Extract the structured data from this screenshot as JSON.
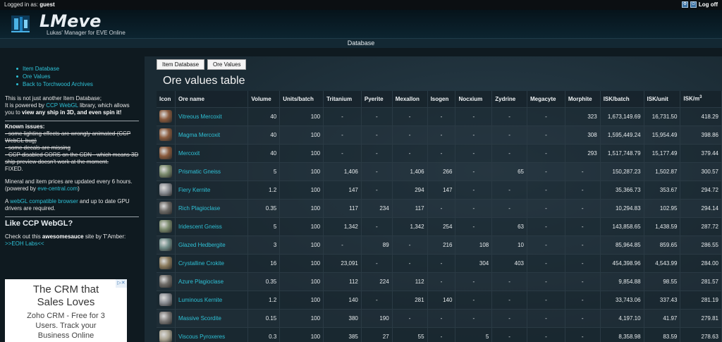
{
  "topbar": {
    "login_label": "Logged in as:",
    "login_user": "guest",
    "logoff": "Log off"
  },
  "header": {
    "title": "LMeve",
    "subtitle": "Lukas' Manager for EVE Online"
  },
  "nav": {
    "current": "Database"
  },
  "sidebar": {
    "links": [
      "Item Database",
      "Ore Values",
      "Back to Torchwood Archives"
    ],
    "intro_1": "This is not just another Item Database;",
    "intro_2_pre": "It is powered by ",
    "intro_2_link": "CCP WebGL",
    "intro_2_post": " library, which allows",
    "intro_3_pre": "you to ",
    "intro_3_bold": "view any ship in 3D, and even spin it!",
    "known_issues": "Known issues:",
    "issue_1": "- some lighting effects are wrongly animated (CCP WebGL bug)",
    "issue_2": "- some decals are missing",
    "issue_3": "- CCP disabled CORS on the CDN - which means 3D ship preview doesn't work at the moment.",
    "fixed": "FIXED.",
    "prices_1": "Mineral and item prices are updated every 6 hours.",
    "prices_2_pre": "(powered by ",
    "prices_2_link": "eve-central.com",
    "prices_2_post": ")",
    "webgl_pre": "A ",
    "webgl_link": "webGL compatible browser",
    "webgl_post": " and up to date GPU drivers are required.",
    "like_heading": "Like CCP WebGL?",
    "check_pre": "Check out this ",
    "check_bold": "awesomesauce",
    "check_post": " site by T'Amber:",
    "eoh_link": ">>EOH Labs<<"
  },
  "ad": {
    "line1": "The CRM that",
    "line2": "Sales Loves",
    "line3": "Zoho CRM - Free for 3",
    "line4": "Users. Track your",
    "line5": "Business Online"
  },
  "main": {
    "tabs": [
      "Item Database",
      "Ore Values"
    ],
    "title": "Ore values table",
    "columns": [
      "Icon",
      "Ore name",
      "Volume",
      "Units/batch",
      "Tritanium",
      "Pyerite",
      "Mexallon",
      "Isogen",
      "Nocxium",
      "Zydrine",
      "Megacyte",
      "Morphite",
      "ISK/batch",
      "ISK/unit",
      "ISK/m"
    ],
    "col_last_sup": "3",
    "rows": [
      {
        "icon_color": "#8a5a3c",
        "name": "Vitreous Mercoxit",
        "cells": [
          "40",
          "100",
          "-",
          "-",
          "-",
          "-",
          "-",
          "-",
          "-",
          "323",
          "1,673,149.69",
          "16,731.50",
          "418.29"
        ]
      },
      {
        "icon_color": "#8a5a3c",
        "name": "Magma Mercoxit",
        "cells": [
          "40",
          "100",
          "-",
          "-",
          "-",
          "-",
          "-",
          "-",
          "-",
          "308",
          "1,595,449.24",
          "15,954.49",
          "398.86"
        ]
      },
      {
        "icon_color": "#8a5a3c",
        "name": "Mercoxit",
        "cells": [
          "40",
          "100",
          "-",
          "-",
          "-",
          "-",
          "-",
          "-",
          "-",
          "293",
          "1,517,748.79",
          "15,177.49",
          "379.44"
        ]
      },
      {
        "icon_color": "#7a8a6c",
        "name": "Prismatic Gneiss",
        "cells": [
          "5",
          "100",
          "1,406",
          "-",
          "1,406",
          "266",
          "-",
          "65",
          "-",
          "-",
          "150,287.23",
          "1,502.87",
          "300.57"
        ]
      },
      {
        "icon_color": "#8c8f95",
        "name": "Fiery Kernite",
        "cells": [
          "1.2",
          "100",
          "147",
          "-",
          "294",
          "147",
          "-",
          "-",
          "-",
          "-",
          "35,366.73",
          "353.67",
          "294.72"
        ]
      },
      {
        "icon_color": "#6d6a66",
        "name": "Rich Plagioclase",
        "cells": [
          "0.35",
          "100",
          "117",
          "234",
          "117",
          "-",
          "-",
          "-",
          "-",
          "-",
          "10,294.83",
          "102.95",
          "294.14"
        ]
      },
      {
        "icon_color": "#7a8a6c",
        "name": "Iridescent Gneiss",
        "cells": [
          "5",
          "100",
          "1,342",
          "-",
          "1,342",
          "254",
          "-",
          "63",
          "-",
          "-",
          "143,858.65",
          "1,438.59",
          "287.72"
        ]
      },
      {
        "icon_color": "#6f8c88",
        "name": "Glazed Hedbergite",
        "cells": [
          "3",
          "100",
          "-",
          "89",
          "-",
          "216",
          "108",
          "10",
          "-",
          "-",
          "85,964.85",
          "859.65",
          "286.55"
        ]
      },
      {
        "icon_color": "#8a7a5c",
        "name": "Crystalline Crokite",
        "cells": [
          "16",
          "100",
          "23,091",
          "-",
          "-",
          "-",
          "304",
          "403",
          "-",
          "-",
          "454,398.96",
          "4,543.99",
          "284.00"
        ]
      },
      {
        "icon_color": "#6d6a66",
        "name": "Azure Plagioclase",
        "cells": [
          "0.35",
          "100",
          "112",
          "224",
          "112",
          "-",
          "-",
          "-",
          "-",
          "-",
          "9,854.88",
          "98.55",
          "281.57"
        ]
      },
      {
        "icon_color": "#8c8f95",
        "name": "Luminous Kernite",
        "cells": [
          "1.2",
          "100",
          "140",
          "-",
          "281",
          "140",
          "-",
          "-",
          "-",
          "-",
          "33,743.06",
          "337.43",
          "281.19"
        ]
      },
      {
        "icon_color": "#7d7a78",
        "name": "Massive Scordite",
        "cells": [
          "0.15",
          "100",
          "380",
          "190",
          "-",
          "-",
          "-",
          "-",
          "-",
          "-",
          "4,197.10",
          "41.97",
          "279.81"
        ]
      },
      {
        "icon_color": "#a8a290",
        "name": "Viscous Pyroxeres",
        "cells": [
          "0.3",
          "100",
          "385",
          "27",
          "55",
          "-",
          "5",
          "-",
          "-",
          "-",
          "8,358.98",
          "83.59",
          "278.63"
        ]
      }
    ]
  }
}
